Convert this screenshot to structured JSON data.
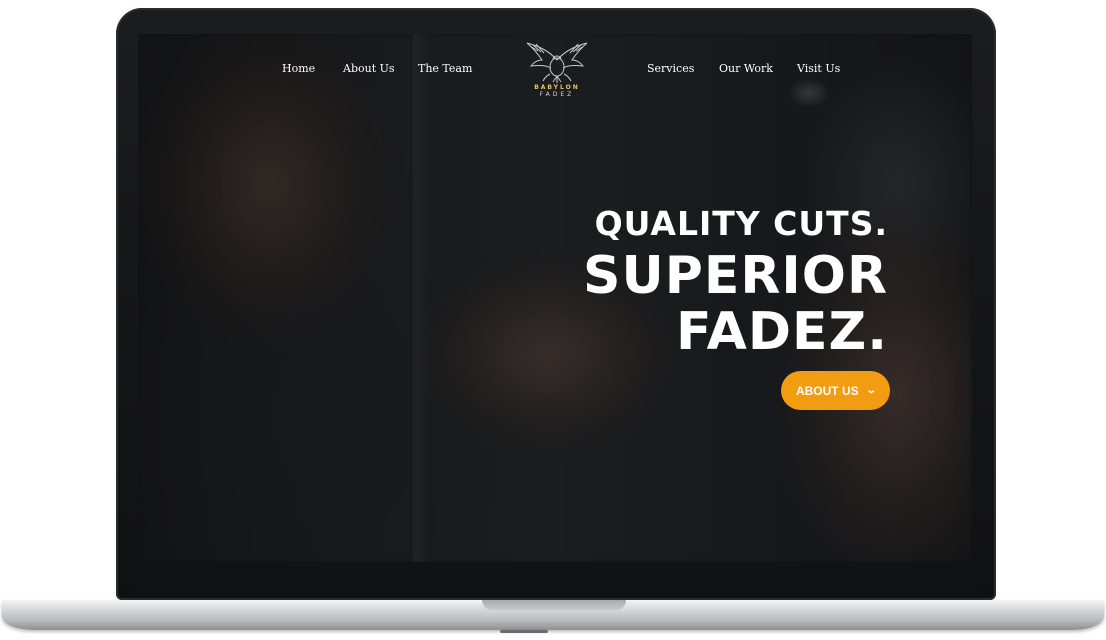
{
  "nav": {
    "left_items": [
      {
        "label": "Home"
      },
      {
        "label": "About Us"
      },
      {
        "label": "The Team"
      }
    ],
    "right_items": [
      {
        "label": "Services"
      },
      {
        "label": "Our Work"
      },
      {
        "label": "Visit Us"
      }
    ]
  },
  "logo": {
    "name": "BABYLON",
    "sub": "FADEZ",
    "icon": "eagle-icon"
  },
  "hero": {
    "line1": "QUALITY CUTS.",
    "line2": "SUPERIOR",
    "line3": "FADEZ.",
    "cta_label": "ABOUT US",
    "cta_icon": "chevron-down-icon"
  },
  "colors": {
    "accent": "#f29c11",
    "logo_gold": "#e8c36a",
    "text": "#ffffff"
  }
}
